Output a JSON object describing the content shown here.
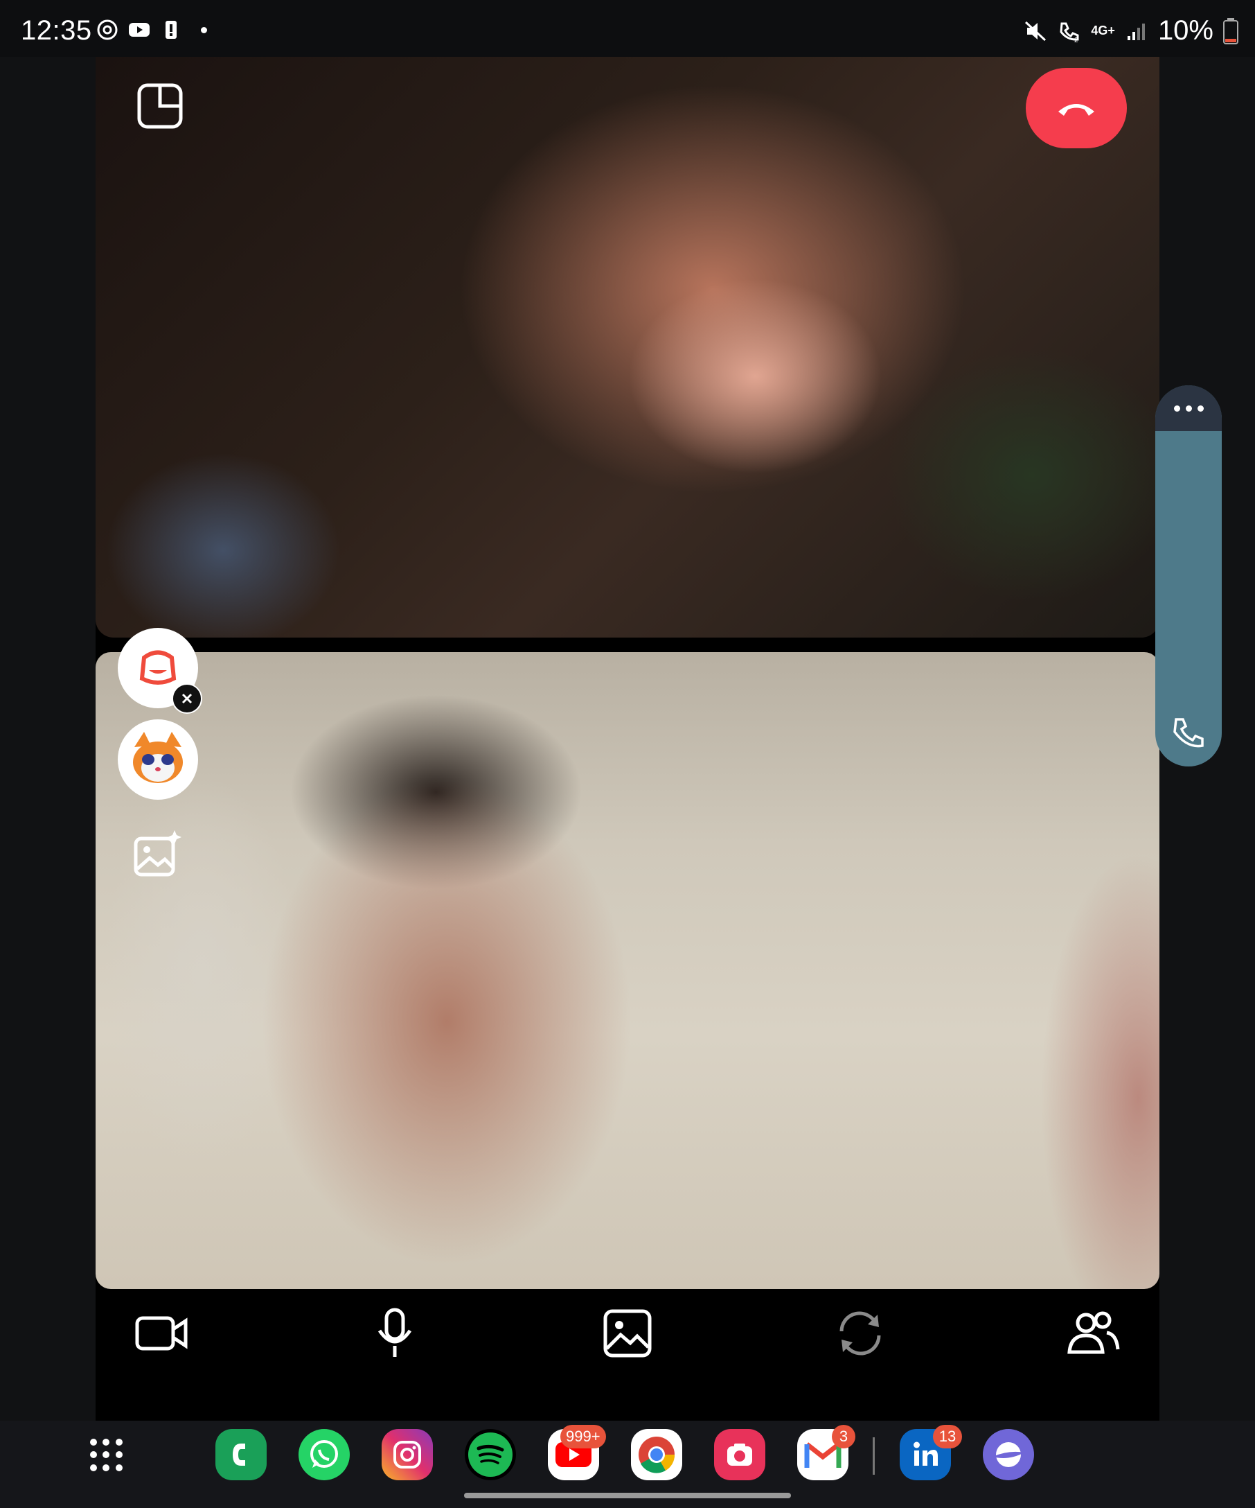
{
  "status_bar": {
    "time": "12:35",
    "battery": "10%",
    "network": "4G+",
    "sim_slot": "2",
    "left_icons": [
      "threads-icon",
      "youtube-icon",
      "battery-alert-icon",
      "notification-dot"
    ],
    "right_icons": [
      "mute-icon",
      "wifi-call-icon",
      "signal-icon",
      "battery-low-icon"
    ]
  },
  "call": {
    "remote_video": "remote-participant-video",
    "self_video": "self-preview-video",
    "controls": [
      "video-camera",
      "microphone",
      "gallery",
      "switch-camera",
      "participants"
    ]
  },
  "effects": [
    "snapchat-style-sticker",
    "cat-avatar-filter",
    "ai-image"
  ],
  "colors": {
    "end_call": "#f53d4d",
    "side_panel": "#4e7a8a",
    "badge": "#e8533b"
  },
  "dock": {
    "apps": [
      {
        "name": "Phone",
        "icon": "phone-app-icon",
        "badge": ""
      },
      {
        "name": "WhatsApp",
        "icon": "whatsapp-icon",
        "badge": ""
      },
      {
        "name": "Instagram",
        "icon": "instagram-icon",
        "badge": ""
      },
      {
        "name": "Spotify",
        "icon": "spotify-icon",
        "badge": ""
      },
      {
        "name": "YouTube",
        "icon": "youtube-app-icon",
        "badge": "999+"
      },
      {
        "name": "Chrome",
        "icon": "chrome-icon",
        "badge": ""
      },
      {
        "name": "Camera",
        "icon": "camera-app-icon",
        "badge": ""
      },
      {
        "name": "Gmail",
        "icon": "gmail-icon",
        "badge": "3"
      },
      {
        "name": "LinkedIn",
        "icon": "linkedin-icon",
        "badge": "13"
      },
      {
        "name": "Internet",
        "icon": "samsung-internet-icon",
        "badge": ""
      }
    ]
  }
}
